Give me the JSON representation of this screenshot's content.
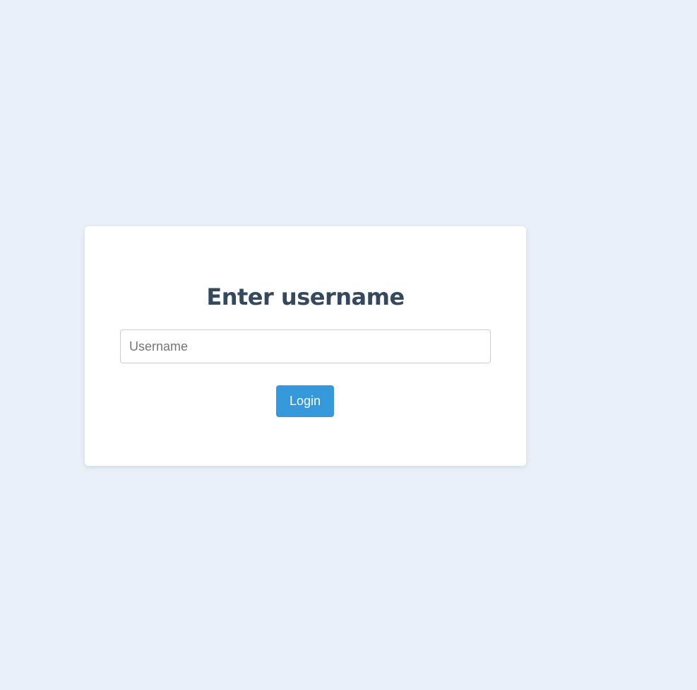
{
  "login_card": {
    "title": "Enter username",
    "username_input": {
      "value": "",
      "placeholder": "Username"
    },
    "login_button_label": "Login"
  },
  "colors": {
    "background": "#e9f0f8",
    "card": "#ffffff",
    "title": "#34495e",
    "button": "#3498db",
    "button_text": "#ffffff"
  }
}
